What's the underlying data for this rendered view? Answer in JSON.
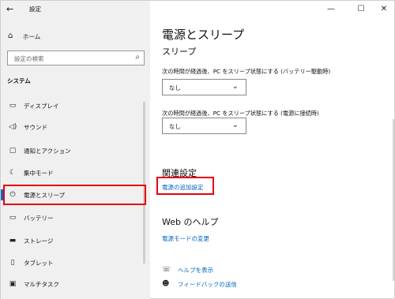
{
  "window": {
    "title": "設定",
    "back_icon": "arrow-left-icon",
    "controls": [
      "minimize",
      "maximize",
      "close"
    ]
  },
  "sidebar": {
    "home_label": "ホーム",
    "search_placeholder": "設定の検索",
    "section_title": "システム",
    "items": [
      {
        "label": "ディスプレイ",
        "icon": "display-icon"
      },
      {
        "label": "サウンド",
        "icon": "speaker-icon"
      },
      {
        "label": "通知とアクション",
        "icon": "notification-icon"
      },
      {
        "label": "集中モード",
        "icon": "moon-icon"
      },
      {
        "label": "電源とスリープ",
        "icon": "power-icon",
        "selected": true
      },
      {
        "label": "バッテリー",
        "icon": "battery-icon"
      },
      {
        "label": "ストレージ",
        "icon": "storage-icon"
      },
      {
        "label": "タブレット",
        "icon": "tablet-icon"
      },
      {
        "label": "マルチタスク",
        "icon": "multitask-icon"
      }
    ]
  },
  "main": {
    "title": "電源とスリープ",
    "sleep_heading": "スリープ",
    "battery_desc": "次の時間が経過後、PC をスリープ状態にする (バッテリー駆動時)",
    "battery_value": "なし",
    "plugged_desc": "次の時間が経過後、PC をスリープ状態にする (電源に接続時)",
    "plugged_value": "なし",
    "related_heading": "関連設定",
    "related_link": "電源の追加設定",
    "web_help_heading": "Web のヘルプ",
    "web_help_link": "電源モードの変更",
    "get_help": "ヘルプを表示",
    "feedback": "フィードバックの送信"
  },
  "colors": {
    "accent": "#0067c0",
    "highlight": "#e60012",
    "sidebar_bg": "#f0f0f0"
  }
}
